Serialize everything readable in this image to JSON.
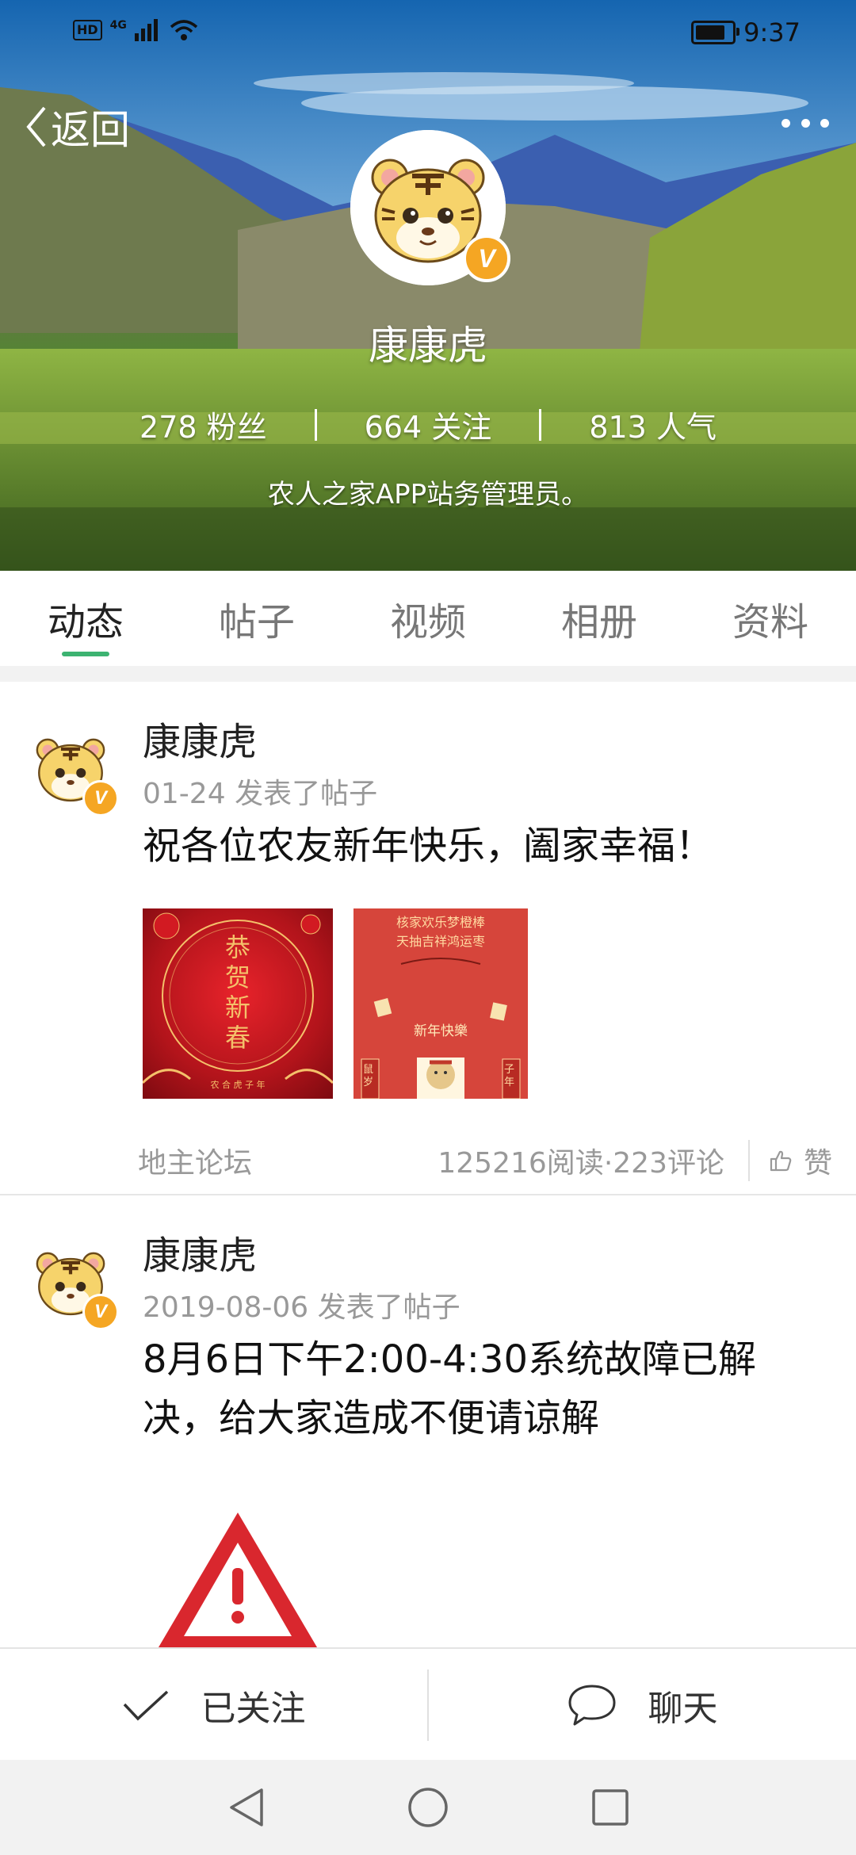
{
  "status_bar": {
    "left_badge": "HD",
    "network": "4G",
    "time": "9:37",
    "battery_level": 0.85
  },
  "header": {
    "back_label": "返回",
    "more_icon": "more-dots-icon",
    "profile_name": "康康虎",
    "stats": [
      {
        "value": "278",
        "label": "粉丝"
      },
      {
        "value": "664",
        "label": "关注"
      },
      {
        "value": "813",
        "label": "人气"
      }
    ],
    "bio": "农人之家APP站务管理员。",
    "verified_badge": "V"
  },
  "tabs": [
    {
      "label": "动态",
      "active": true
    },
    {
      "label": "帖子",
      "active": false
    },
    {
      "label": "视频",
      "active": false
    },
    {
      "label": "相册",
      "active": false
    },
    {
      "label": "资料",
      "active": false
    }
  ],
  "posts": [
    {
      "author": "康康虎",
      "date": "01-24",
      "action": "发表了帖子",
      "text": "祝各位农友新年快乐，阖家幸福！",
      "images": [
        {
          "lines": [
            "恭",
            "贺",
            "新",
            "春"
          ],
          "footer": "农 合 虎 子 年"
        },
        {
          "top_lines": [
            "核家欢乐梦橙棒",
            "天抽吉祥鸿运枣"
          ],
          "title": "新年快樂",
          "left_tag": "鼠岁",
          "right_tag": "子年"
        }
      ],
      "forum": "地主论坛",
      "reads": "125216阅读",
      "separator": "·",
      "comments": "223评论",
      "like_label": "赞"
    },
    {
      "author": "康康虎",
      "date": "2019-08-06",
      "action": "发表了帖子",
      "text_line1": "8月6日下午2:00-4:30系统故障已解",
      "text_line2": "决，给大家造成不便请谅解"
    }
  ],
  "actions": {
    "follow_label": "已关注",
    "chat_label": "聊天"
  },
  "colors": {
    "accent": "#3cb371",
    "badge": "#f5a623"
  }
}
